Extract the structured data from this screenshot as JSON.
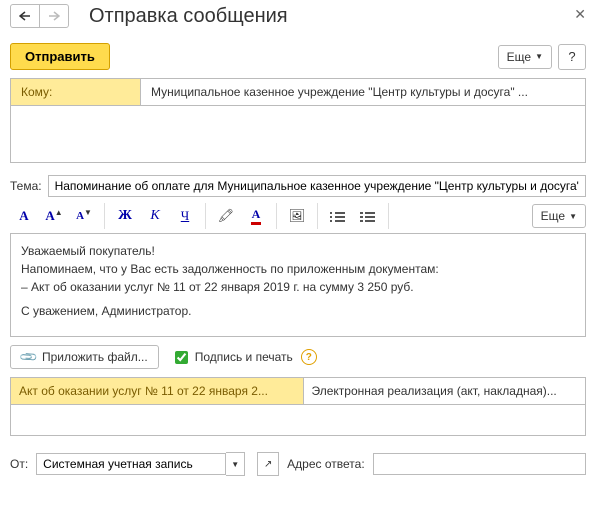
{
  "title": "Отправка сообщения",
  "buttons": {
    "send": "Отправить",
    "more": "Еще",
    "help": "?",
    "attach": "Приложить файл...",
    "signature": "Подпись и печать"
  },
  "to": {
    "label": "Кому:",
    "value": "Муниципальное казенное учреждение \"Центр культуры и досуга\" ..."
  },
  "subject": {
    "label": "Тема:",
    "value": "Напоминание об оплате для Муниципальное казенное учреждение \"Центр культуры и досуга\""
  },
  "body": {
    "l1": "Уважаемый покупатель!",
    "l2": "Напоминаем, что у Вас есть задолженность по приложенным документам:",
    "l3": " – Акт об оказании услуг № 11 от 22 января 2019 г. на сумму 3 250 руб.",
    "l4": "С уважением, Администратор."
  },
  "docs": {
    "selected": "Акт об оказании услуг № 11 от 22 января 2...",
    "other": "Электронная реализация (акт, накладная)..."
  },
  "from": {
    "label": "От:",
    "value": "Системная учетная запись",
    "reply_label": "Адрес ответа:",
    "reply_value": ""
  },
  "fmt_more": "Еще"
}
